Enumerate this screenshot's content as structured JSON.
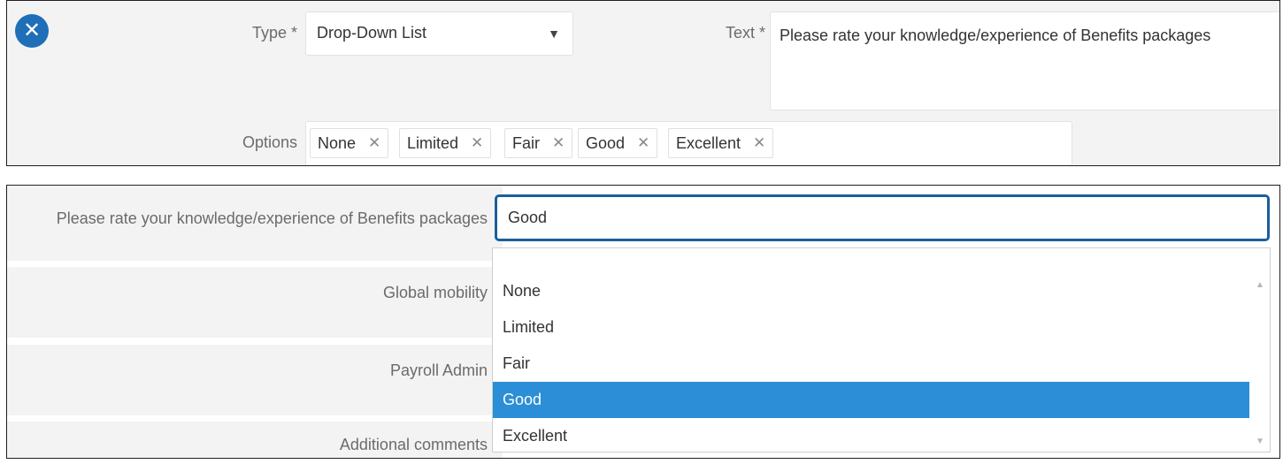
{
  "editor": {
    "close_glyph": "✕",
    "type_label": "Type *",
    "type_value": "Drop-Down List",
    "text_label": "Text *",
    "text_value": "Please rate your knowledge/experience of Benefits packages",
    "options_label": "Options",
    "options": [
      "None",
      "Limited",
      "Fair",
      "Good",
      "Excellent"
    ],
    "remove_glyph": "✕",
    "caret_glyph": "▼"
  },
  "form": {
    "question_label": "Please rate your knowledge/experience of Benefits packages",
    "selected_value": "Good",
    "other_rows": [
      "Global mobility",
      "Payroll Admin",
      "Additional comments"
    ],
    "dropdown_options": [
      "None",
      "Limited",
      "Fair",
      "Good",
      "Excellent"
    ],
    "highlighted_option": "Good",
    "scroll_up_glyph": "▲",
    "scroll_down_glyph": "▼"
  },
  "colors": {
    "accent": "#1f6eb8",
    "focus_border": "#1a5f9c",
    "highlight": "#2b8ed6",
    "panel_bg": "#f3f3f3"
  }
}
